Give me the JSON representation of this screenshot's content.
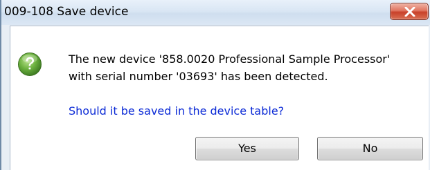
{
  "window": {
    "title": "009-108 Save device"
  },
  "dialog": {
    "icon": "question-icon",
    "message_line_1": "The new device '858.0020 Professional Sample Processor'",
    "message_line_2": "with serial number '03693' has been detected.",
    "instruction": "Should it be saved in the device table?"
  },
  "buttons": {
    "yes_label": "Yes",
    "no_label": "No"
  },
  "colors": {
    "instruction_text": "#0b2ad6",
    "close_button": "#c8412a",
    "icon_green": "#5fa23a"
  }
}
